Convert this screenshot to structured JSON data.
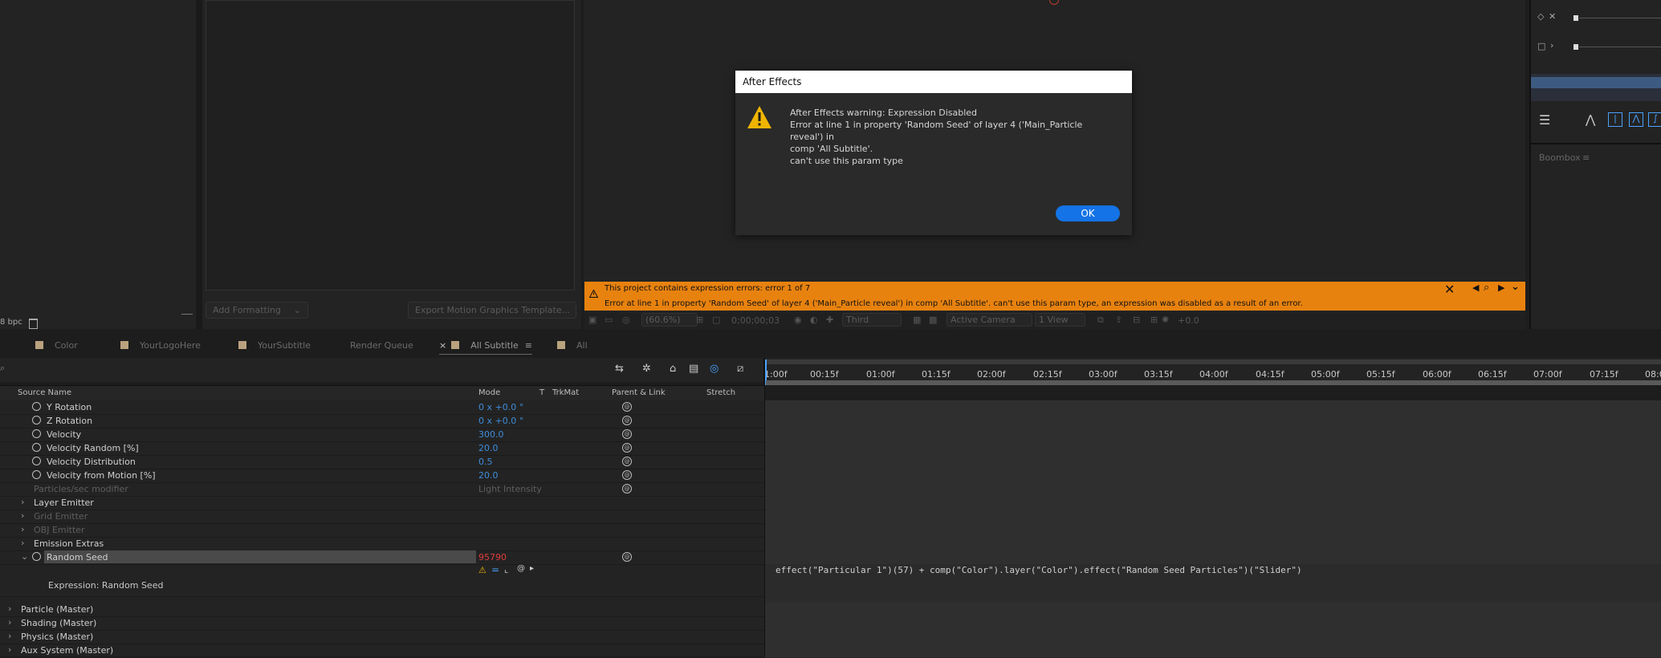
{
  "top_left": {
    "bpc": "8 bpc"
  },
  "essential_graphics": {
    "add_formatting": "Add Formatting",
    "export_template": "Export Motion Graphics Template..."
  },
  "dialog": {
    "title": "After Effects",
    "line1": "After Effects warning: Expression Disabled",
    "line2": "Error at line 1 in property 'Random Seed' of layer 4 ('Main_Particle reveal') in",
    "line3": "comp 'All Subtitle'.",
    "line4": "can't use this param type",
    "ok": "OK"
  },
  "error_banner": {
    "headline": "This project contains expression errors: error 1 of 7",
    "detail": "Error at line 1 in property 'Random Seed' of layer 4 ('Main_Particle reveal') in comp 'All Subtitle'.  can't use this param type, an expression was disabled as a result of an error."
  },
  "viewer_toolbar": {
    "zoom": "(60.6%)",
    "timecode": "0;00;00;03",
    "resolution": "Third",
    "camera": "Active Camera",
    "views": "1 View",
    "exposure": "+0.0"
  },
  "right_panel": {
    "boombox": "Boombox"
  },
  "tabs": [
    {
      "label": "Color",
      "swatch": true
    },
    {
      "label": "YourLogoHere",
      "swatch": true
    },
    {
      "label": "YourSubtitle",
      "swatch": true
    },
    {
      "label": "Render Queue",
      "swatch": false
    },
    {
      "label": "All Subtitle",
      "swatch": true
    },
    {
      "label": "All",
      "swatch": true
    }
  ],
  "columns": {
    "source_name": "Source Name",
    "mode": "Mode",
    "t": "T",
    "trkmat": "TrkMat",
    "parent": "Parent & Link",
    "stretch": "Stretch"
  },
  "ruler": [
    "1:00f",
    "00:15f",
    "01:00f",
    "01:15f",
    "02:00f",
    "02:15f",
    "03:00f",
    "03:15f",
    "04:00f",
    "04:15f",
    "05:00f",
    "05:15f",
    "06:00f",
    "06:15f",
    "07:00f",
    "07:15f",
    "08:0"
  ],
  "layers": {
    "y_rotation": {
      "name": "Y Rotation",
      "value": "0 x +0.0 °"
    },
    "z_rotation": {
      "name": "Z Rotation",
      "value": "0 x +0.0 °"
    },
    "velocity": {
      "name": "Velocity",
      "value": "300.0"
    },
    "velocity_random": {
      "name": "Velocity Random [%]",
      "value": "20.0"
    },
    "velocity_distribution": {
      "name": "Velocity Distribution",
      "value": "0.5"
    },
    "velocity_from_motion": {
      "name": "Velocity from Motion [%]",
      "value": "20.0"
    },
    "particles_sec_modifier": {
      "name": "Particles/sec modifier",
      "value": "Light Intensity"
    },
    "layer_emitter": "Layer Emitter",
    "grid_emitter": "Grid Emitter",
    "obj_emitter": "OBJ Emitter",
    "emission_extras": "Emission Extras",
    "random_seed": {
      "name": "Random Seed",
      "value": "95790"
    },
    "expression_label": "Expression: Random Seed",
    "particle_master": "Particle (Master)",
    "shading_master": "Shading (Master)",
    "physics_master": "Physics (Master)",
    "aux_master": "Aux System (Master)"
  },
  "expression_code": "effect(\"Particular 1\")(57) + comp(\"Color\").layer(\"Color\").effect(\"Random Seed Particles\")(\"Slider\")",
  "colors": {
    "accent_blue": "#1473e6",
    "banner_orange": "#e8820f",
    "value_blue": "#3f8ddb",
    "error_red": "#e23b3b",
    "warning_yellow": "#f0b400"
  }
}
